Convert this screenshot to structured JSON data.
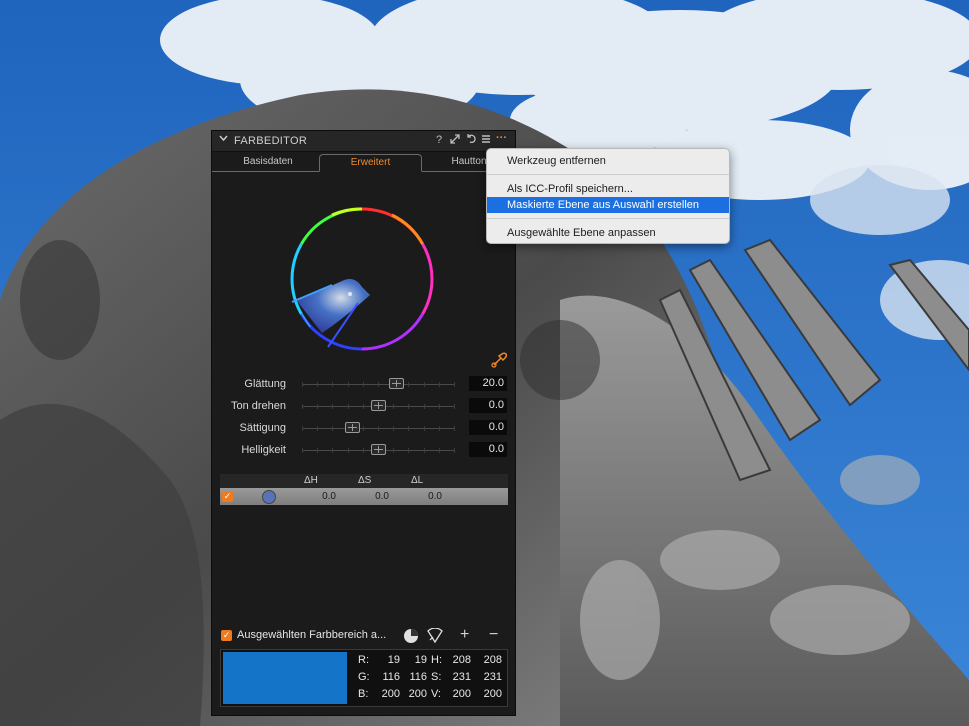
{
  "panel": {
    "title": "FARBEDITOR",
    "header_icons": {
      "help": "?",
      "expand": "expand-icon",
      "reset": "reset-icon",
      "list": "list-icon",
      "more": "···"
    },
    "tabs": [
      {
        "label": "Basisdaten"
      },
      {
        "label": "Erweitert"
      },
      {
        "label": "Hautton"
      }
    ],
    "active_tab": "Erweitert",
    "sliders": [
      {
        "label": "Glättung",
        "value": "20.0",
        "fraction": 0.62
      },
      {
        "label": "Ton drehen",
        "value": "0.0",
        "fraction": 0.5
      },
      {
        "label": "Sättigung",
        "value": "0.0",
        "fraction": 0.33
      },
      {
        "label": "Helligkeit",
        "value": "0.0",
        "fraction": 0.5
      }
    ],
    "table": {
      "headers": [
        "ΔH",
        "ΔS",
        "ΔL"
      ],
      "rows": [
        {
          "checked": true,
          "dh": "0.0",
          "ds": "0.0",
          "dl": "0.0",
          "swatch_color": "#5a72b8"
        }
      ]
    },
    "bottom": {
      "checked": true,
      "label": "Ausgewählten Farbbereich a...",
      "plus": "+",
      "minus": "−"
    },
    "readout": {
      "swatch_color": "#1374c8",
      "r_label": "R:",
      "r1": "19",
      "r2": "19",
      "g_label": "G:",
      "g1": "116",
      "g2": "116",
      "b_label": "B:",
      "b1": "200",
      "b2": "200",
      "h_label": "H:",
      "h1": "208",
      "h2": "208",
      "s_label": "S:",
      "s1": "231",
      "s2": "231",
      "v_label": "V:",
      "v1": "200",
      "v2": "200"
    }
  },
  "menu": {
    "items": [
      {
        "label": "Werkzeug entfernen"
      },
      {
        "label": "Als ICC-Profil speichern..."
      },
      {
        "label": "Maskierte Ebene aus Auswahl erstellen",
        "selected": true
      },
      {
        "label": "Ausgewählte Ebene anpassen"
      }
    ]
  },
  "colors": {
    "accent": "#f08a2c",
    "menu_highlight": "#1b6fe0",
    "sky": "#2a6fc4"
  }
}
